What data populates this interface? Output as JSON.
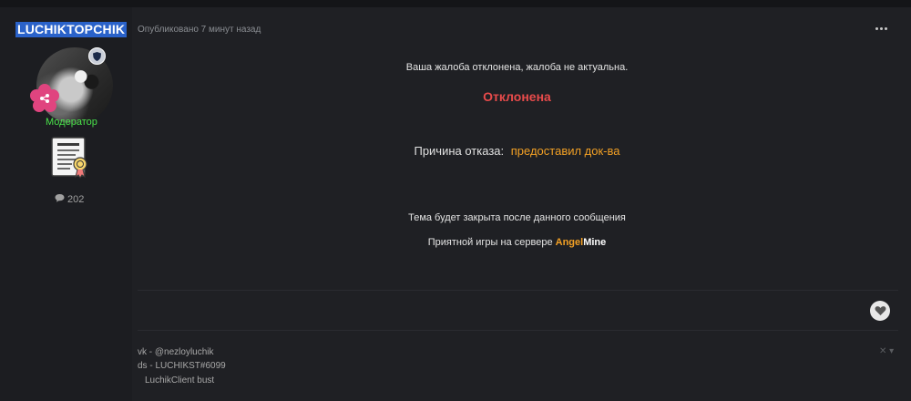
{
  "author": {
    "username": "LUCHIKTOPCHIK",
    "rank": "Модератор",
    "post_count": "202",
    "icons": {
      "avatar": "avatar-image",
      "badge": "shield-icon",
      "group": "flower-badge-icon",
      "award": "certificate-icon",
      "posts": "comment-icon"
    }
  },
  "post": {
    "published": "Опубликовано 7 минут назад",
    "line1": "Ваша жалоба отклонена, жалоба не актуальна.",
    "status": "Отклонена",
    "reason_label": "Причина отказа:",
    "reason_value": "предоставил док-ва",
    "line4": "Тема будет закрыта после данного сообщения",
    "line5_prefix": "Приятной игры на сервере",
    "server_part1": "Angel",
    "server_part2": "Mine"
  },
  "signature": {
    "line1": "vk - @nezloyluchik",
    "line2": "ds - LUCHIKST#6099",
    "line3": "LuchikClient bust"
  },
  "colors": {
    "background": "#1f2024",
    "status_red": "#e84b4b",
    "accent_orange": "#f2a025",
    "rank_green": "#49e34a",
    "username_bg": "#2a62c9"
  }
}
